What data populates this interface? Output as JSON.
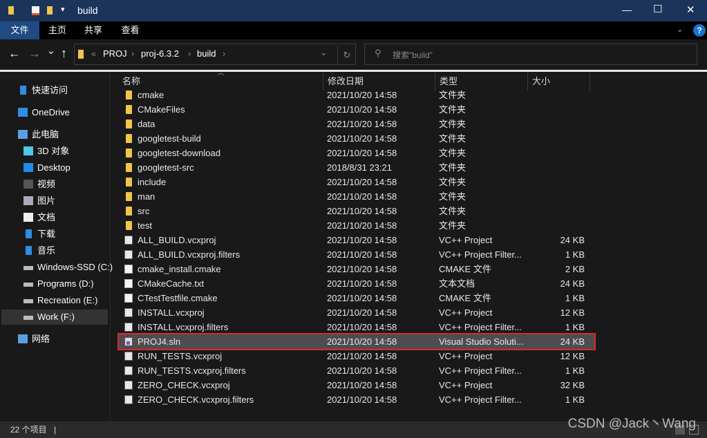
{
  "window": {
    "title": "build",
    "controls": {
      "minimize": "—",
      "maximize": "☐",
      "close": "✕"
    }
  },
  "ribbon": {
    "tabs": [
      "文件",
      "主页",
      "共享",
      "查看"
    ],
    "help": "?",
    "accent": "#1f4a82"
  },
  "nav": {
    "back": "←",
    "forward": "→",
    "recent": "⌄",
    "up": "↑",
    "breadcrumb": [
      "PROJ",
      "proj-6.3.2",
      "build"
    ],
    "overflow": "«",
    "refresh": "↻",
    "search_placeholder": "搜索\"build\""
  },
  "sidebar": {
    "items": [
      {
        "label": "快速访问",
        "icon": "star-icon"
      },
      {
        "label": "OneDrive",
        "icon": "cloud-icon"
      },
      {
        "label": "此电脑",
        "icon": "computer-icon"
      },
      {
        "label": "3D 对象",
        "icon": "cube-icon"
      },
      {
        "label": "Desktop",
        "icon": "desktop-icon"
      },
      {
        "label": "视频",
        "icon": "video-icon"
      },
      {
        "label": "图片",
        "icon": "picture-icon"
      },
      {
        "label": "文档",
        "icon": "document-icon"
      },
      {
        "label": "下载",
        "icon": "download-icon"
      },
      {
        "label": "音乐",
        "icon": "music-icon"
      },
      {
        "label": "Windows-SSD (C:)",
        "icon": "drive-icon"
      },
      {
        "label": "Programs (D:)",
        "icon": "drive-icon"
      },
      {
        "label": "Recreation (E:)",
        "icon": "drive-icon"
      },
      {
        "label": "Work (F:)",
        "icon": "drive-icon",
        "selected": true
      },
      {
        "label": "网络",
        "icon": "network-icon"
      }
    ]
  },
  "columns": [
    "名称",
    "修改日期",
    "类型",
    "大小"
  ],
  "files": [
    {
      "name": "cmake",
      "date": "2021/10/20 14:58",
      "type": "文件夹",
      "size": "",
      "icon": "folder"
    },
    {
      "name": "CMakeFiles",
      "date": "2021/10/20 14:58",
      "type": "文件夹",
      "size": "",
      "icon": "folder"
    },
    {
      "name": "data",
      "date": "2021/10/20 14:58",
      "type": "文件夹",
      "size": "",
      "icon": "folder"
    },
    {
      "name": "googletest-build",
      "date": "2021/10/20 14:58",
      "type": "文件夹",
      "size": "",
      "icon": "folder"
    },
    {
      "name": "googletest-download",
      "date": "2021/10/20 14:58",
      "type": "文件夹",
      "size": "",
      "icon": "folder"
    },
    {
      "name": "googletest-src",
      "date": "2018/8/31 23:21",
      "type": "文件夹",
      "size": "",
      "icon": "folder"
    },
    {
      "name": "include",
      "date": "2021/10/20 14:58",
      "type": "文件夹",
      "size": "",
      "icon": "folder"
    },
    {
      "name": "man",
      "date": "2021/10/20 14:58",
      "type": "文件夹",
      "size": "",
      "icon": "folder"
    },
    {
      "name": "src",
      "date": "2021/10/20 14:58",
      "type": "文件夹",
      "size": "",
      "icon": "folder"
    },
    {
      "name": "test",
      "date": "2021/10/20 14:58",
      "type": "文件夹",
      "size": "",
      "icon": "folder"
    },
    {
      "name": "ALL_BUILD.vcxproj",
      "date": "2021/10/20 14:58",
      "type": "VC++ Project",
      "size": "24 KB",
      "icon": "proj"
    },
    {
      "name": "ALL_BUILD.vcxproj.filters",
      "date": "2021/10/20 14:58",
      "type": "VC++ Project Filter...",
      "size": "1 KB",
      "icon": "proj"
    },
    {
      "name": "cmake_install.cmake",
      "date": "2021/10/20 14:58",
      "type": "CMAKE 文件",
      "size": "2 KB",
      "icon": "doc"
    },
    {
      "name": "CMakeCache.txt",
      "date": "2021/10/20 14:58",
      "type": "文本文档",
      "size": "24 KB",
      "icon": "doc"
    },
    {
      "name": "CTestTestfile.cmake",
      "date": "2021/10/20 14:58",
      "type": "CMAKE 文件",
      "size": "1 KB",
      "icon": "doc"
    },
    {
      "name": "INSTALL.vcxproj",
      "date": "2021/10/20 14:58",
      "type": "VC++ Project",
      "size": "12 KB",
      "icon": "proj"
    },
    {
      "name": "INSTALL.vcxproj.filters",
      "date": "2021/10/20 14:58",
      "type": "VC++ Project Filter...",
      "size": "1 KB",
      "icon": "proj"
    },
    {
      "name": "PROJ4.sln",
      "date": "2021/10/20 14:58",
      "type": "Visual Studio Soluti...",
      "size": "24 KB",
      "icon": "sln",
      "selected": true
    },
    {
      "name": "RUN_TESTS.vcxproj",
      "date": "2021/10/20 14:58",
      "type": "VC++ Project",
      "size": "12 KB",
      "icon": "proj"
    },
    {
      "name": "RUN_TESTS.vcxproj.filters",
      "date": "2021/10/20 14:58",
      "type": "VC++ Project Filter...",
      "size": "1 KB",
      "icon": "proj"
    },
    {
      "name": "ZERO_CHECK.vcxproj",
      "date": "2021/10/20 14:58",
      "type": "VC++ Project",
      "size": "32 KB",
      "icon": "proj"
    },
    {
      "name": "ZERO_CHECK.vcxproj.filters",
      "date": "2021/10/20 14:58",
      "type": "VC++ Project Filter...",
      "size": "1 KB",
      "icon": "proj"
    }
  ],
  "status": {
    "count": "22 个项目"
  },
  "watermark": "CSDN @Jack丶Wang"
}
